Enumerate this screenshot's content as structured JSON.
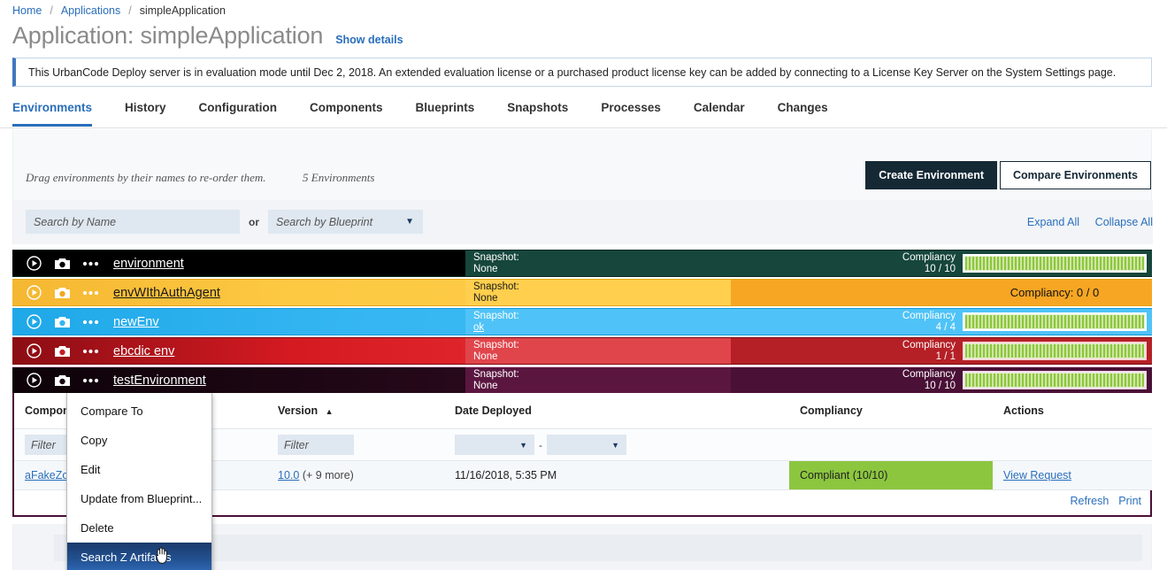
{
  "breadcrumb": {
    "items": [
      {
        "label": "Home",
        "link": true
      },
      {
        "label": "Applications",
        "link": true
      },
      {
        "label": "simpleApplication",
        "link": false
      }
    ],
    "separator": "/"
  },
  "header": {
    "title": "Application: simpleApplication",
    "show_details": "Show details"
  },
  "banner": {
    "message": "This UrbanCode Deploy server is in evaluation mode until Dec 2, 2018. An extended evaluation license or a purchased product license key can be added by connecting to a License Key Server on the System Settings page.",
    "accent_color": "#4178be"
  },
  "tabs": [
    {
      "label": "Environments",
      "active": true
    },
    {
      "label": "History",
      "active": false
    },
    {
      "label": "Configuration",
      "active": false
    },
    {
      "label": "Components",
      "active": false
    },
    {
      "label": "Blueprints",
      "active": false
    },
    {
      "label": "Snapshots",
      "active": false
    },
    {
      "label": "Processes",
      "active": false
    },
    {
      "label": "Calendar",
      "active": false
    },
    {
      "label": "Changes",
      "active": false
    }
  ],
  "toolbar": {
    "drag_hint": "Drag environments by their names to re-order them.",
    "environment_count": "5 Environments",
    "create_environment": "Create Environment",
    "compare_environments": "Compare Environments",
    "expand_all": "Expand All",
    "collapse_all": "Collapse All"
  },
  "search": {
    "by_name_placeholder": "Search by Name",
    "or_label": "or",
    "by_blueprint_label": "Search by Blueprint",
    "caret": "▼"
  },
  "environments": [
    {
      "name": "environment",
      "snapshot_label": "Snapshot:",
      "snapshot_value": "None",
      "snapshot_is_link": false,
      "compliancy_label": "Compliancy",
      "compliancy_value": "10 / 10",
      "show_bar": true,
      "zero_text": "",
      "bg": "linear-gradient(to right, #000000 0%, #000000 40%, #000000 100%)",
      "mid_bg": "#16463c",
      "right_bg": "#16463c",
      "text": "#ffffff",
      "border": "#0d2b25"
    },
    {
      "name": "envWIthAuthAgent",
      "snapshot_label": "Snapshot:",
      "snapshot_value": "None",
      "snapshot_is_link": false,
      "compliancy_label": "",
      "compliancy_value": "",
      "show_bar": false,
      "zero_text": "Compliancy: 0 / 0",
      "bg": "linear-gradient(to right, #f5b731 0%, #fdc943 25%, #ffcf4d 100%)",
      "mid_bg": "#ffcf4d",
      "right_bg": "#f6a623",
      "text": "#1a1a1a",
      "border": "#e0a419"
    },
    {
      "name": "newEnv",
      "snapshot_label": "Snapshot:",
      "snapshot_value": "ok",
      "snapshot_is_link": true,
      "compliancy_label": "Compliancy",
      "compliancy_value": "4 / 4",
      "show_bar": true,
      "zero_text": "",
      "bg": "linear-gradient(to right, #1fa8e8 0%, #35b6f2 30%, #4fc3f7 100%)",
      "mid_bg": "#4fc3f7",
      "right_bg": "#4fc3f7",
      "text": "#ffffff",
      "border": "#149ad8"
    },
    {
      "name": "ebcdic env",
      "snapshot_label": "Snapshot:",
      "snapshot_value": "None",
      "snapshot_is_link": false,
      "compliancy_label": "Compliancy",
      "compliancy_value": "1 / 1",
      "show_bar": true,
      "zero_text": "",
      "bg": "linear-gradient(to right, #8c0d14 0%, #d61a22 25%, #ef3b3b 70%, #e94b4b 100%)",
      "mid_bg": "#e0454b",
      "right_bg": "#b52026",
      "text": "#ffffff",
      "border": "#7c0a10"
    },
    {
      "name": "testEnvironment",
      "snapshot_label": "Snapshot:",
      "snapshot_value": "None",
      "snapshot_is_link": false,
      "compliancy_label": "Compliancy",
      "compliancy_value": "10 / 10",
      "show_bar": true,
      "zero_text": "",
      "bg": "linear-gradient(to right, #0d0208 0%, #2a0a1d 45%, #4d1235 100%)",
      "mid_bg": "#5b1640",
      "right_bg": "#4a1036",
      "text": "#ffffff",
      "border": "#f0c8e0"
    }
  ],
  "icons": {
    "play": "play-icon",
    "camera": "camera-icon",
    "more": "more-options-icon"
  },
  "detail_table": {
    "columns": [
      "Component",
      "Version",
      "Date Deployed",
      "Compliancy",
      "Actions"
    ],
    "sort_column": "Version",
    "sort_indicator": "▲",
    "filters": {
      "component_placeholder": "Filter",
      "version_placeholder": "Filter",
      "date_from": "",
      "date_to": "",
      "date_separator": "-",
      "caret": "▼"
    },
    "rows": [
      {
        "component": "aFakeZos",
        "version": "10.0",
        "version_more": "(+ 9 more)",
        "date_deployed": "11/16/2018, 5:35 PM",
        "compliancy": "Compliant (10/10)",
        "action": "View Request"
      }
    ],
    "footer": {
      "refresh": "Refresh",
      "print": "Print"
    }
  },
  "context_menu": {
    "items": [
      {
        "label": "Compare To",
        "highlighted": false
      },
      {
        "label": "Copy",
        "highlighted": false
      },
      {
        "label": "Edit",
        "highlighted": false
      },
      {
        "label": "Update from Blueprint...",
        "highlighted": false
      },
      {
        "label": "Delete",
        "highlighted": false
      },
      {
        "label": "Search Z Artifacts",
        "highlighted": true
      }
    ]
  },
  "colors": {
    "link": "#2a6ebb",
    "primary_button": "#152935",
    "compliant_green": "#8cc63f",
    "menu_highlight": "#22508f"
  }
}
